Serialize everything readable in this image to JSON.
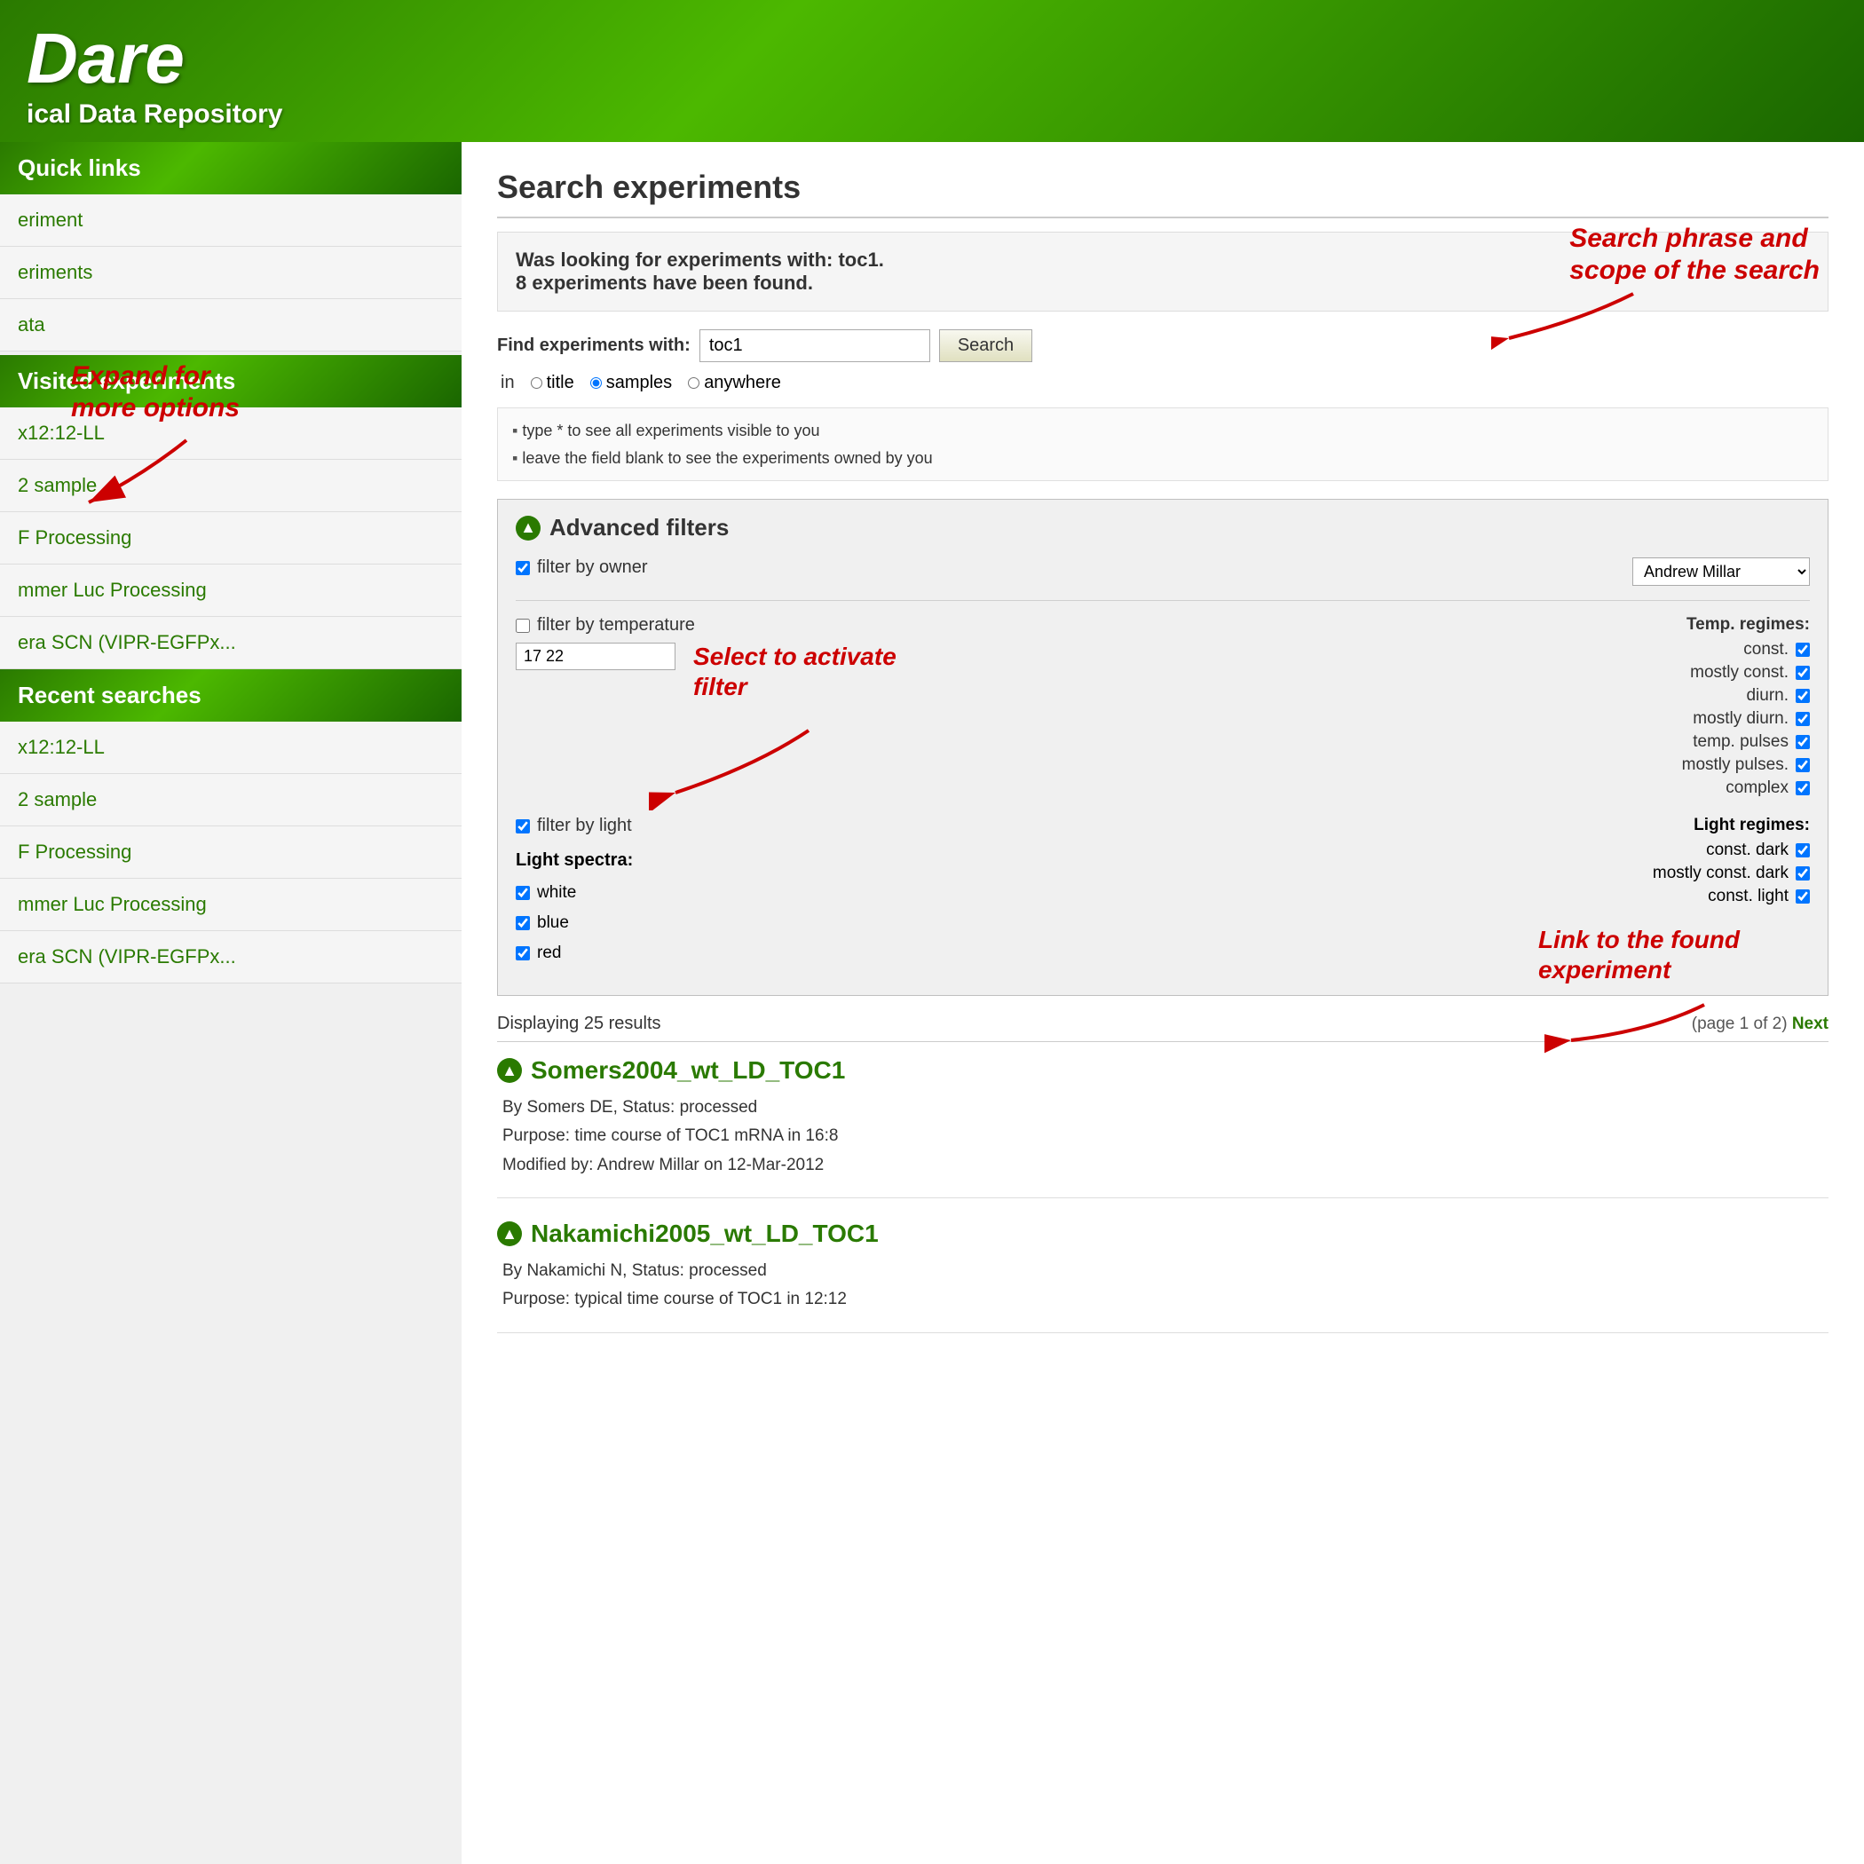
{
  "header": {
    "title": "Dare",
    "subtitle": "ical Data Repository"
  },
  "sidebar": {
    "quick_links_label": "Quick links",
    "quick_links_items": [
      {
        "label": "eriment"
      },
      {
        "label": "eriments"
      },
      {
        "label": "ata"
      }
    ],
    "visited_label": "Visited experiments",
    "visited_items": [
      {
        "label": "x12:12-LL"
      },
      {
        "label": "2 sample"
      },
      {
        "label": "F Processing"
      },
      {
        "label": "mmer Luc Processing"
      },
      {
        "label": "era SCN (VIPR-EGFPx..."
      }
    ],
    "recent_label": "Recent searches",
    "recent_items": [
      {
        "label": "x12:12-LL"
      },
      {
        "label": "2 sample"
      },
      {
        "label": "F Processing"
      },
      {
        "label": "mmer Luc Processing"
      },
      {
        "label": "era SCN (VIPR-EGFPx..."
      }
    ],
    "annotation_expand": "Expand for\nmore options"
  },
  "main": {
    "page_title": "Search experiments",
    "search_info": "Was looking for experiments with: toc1.\n8 experiments have been found.",
    "annotation_search_phrase": "Search phrase and\nscope of the search",
    "find_label": "Find experiments with:",
    "search_value": "toc1",
    "search_button": "Search",
    "scope_label": "in",
    "scope_options": [
      {
        "label": "title",
        "value": "title",
        "selected": false
      },
      {
        "label": "samples",
        "value": "samples",
        "selected": true
      },
      {
        "label": "anywhere",
        "value": "anywhere",
        "selected": false
      }
    ],
    "hints": [
      "type * to see all experiments visible to you",
      "leave the field blank to see the experiments owned by you"
    ],
    "advanced_filters_label": "Advanced filters",
    "filter_owner_label": "filter by owner",
    "filter_owner_checked": true,
    "owner_value": "Andrew Millar",
    "filter_temp_label": "filter by temperature",
    "filter_temp_checked": false,
    "temp_value": "17 22",
    "temp_regimes_label": "Temp. regimes:",
    "temp_regimes": [
      {
        "label": "const.",
        "checked": true
      },
      {
        "label": "mostly const.",
        "checked": true
      },
      {
        "label": "diurn.",
        "checked": true
      },
      {
        "label": "mostly diurn.",
        "checked": true
      },
      {
        "label": "temp. pulses",
        "checked": true
      },
      {
        "label": "mostly pulses.",
        "checked": true
      },
      {
        "label": "complex",
        "checked": true
      }
    ],
    "annotation_select_filter": "Select to activate\nfilter",
    "filter_light_label": "filter by light",
    "filter_light_checked": true,
    "light_spectra_label": "Light spectra:",
    "light_spectra": [
      {
        "label": "white",
        "checked": true
      },
      {
        "label": "blue",
        "checked": true
      },
      {
        "label": "red",
        "checked": true
      }
    ],
    "light_regimes_label": "Light regimes:",
    "light_regimes": [
      {
        "label": "const. dark",
        "checked": true
      },
      {
        "label": "mostly const. dark",
        "checked": true
      },
      {
        "label": "const. light",
        "checked": true
      }
    ],
    "displaying_label": "Displaying 25 results",
    "pagination": "(page 1 of 2)",
    "next_label": "Next",
    "annotation_link": "Link to the found\nexperiment",
    "experiments": [
      {
        "title": "Somers2004_wt_LD_TOC1",
        "by": "By Somers DE, Status: processed",
        "purpose": "Purpose: time course of TOC1 mRNA in 16:8",
        "modified": "Modified by: Andrew Millar on 12-Mar-2012"
      },
      {
        "title": "Nakamichi2005_wt_LD_TOC1",
        "by": "By Nakamichi N, Status: processed",
        "purpose": "Purpose: typical time course of TOC1 in 12:12"
      }
    ]
  }
}
